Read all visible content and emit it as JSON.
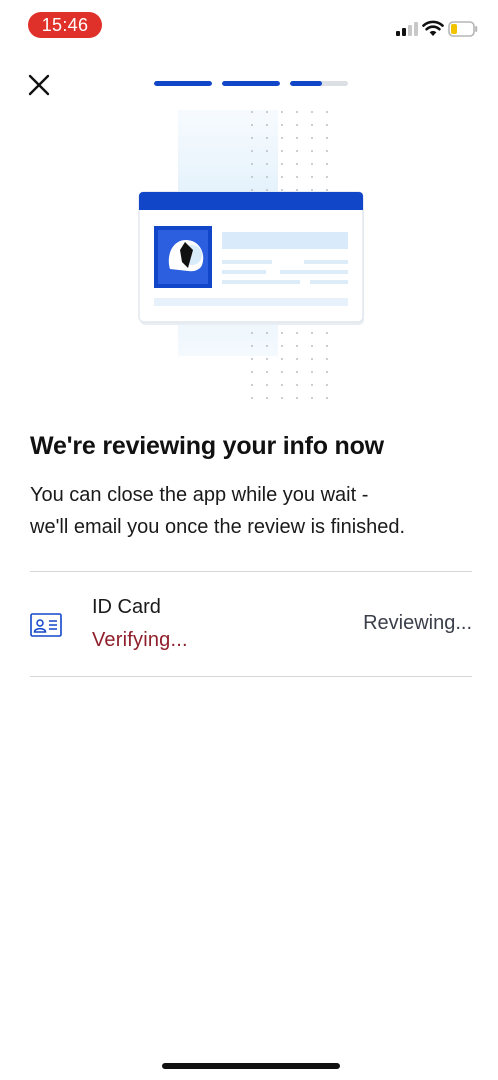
{
  "status_bar": {
    "time": "15:46",
    "time_pill_color": "#e0302a",
    "signal_icon": "cellular-signal-icon",
    "wifi_icon": "wifi-icon",
    "battery_icon": "battery-low-icon",
    "battery_level": 0.2
  },
  "top_bar": {
    "close_icon": "close-icon",
    "progress_steps": [
      1.0,
      1.0,
      0.55
    ],
    "accent_color": "#1246c9"
  },
  "illustration": {
    "icon": "id-card-illustration-icon"
  },
  "content": {
    "title": "We're reviewing your info now",
    "body_line_1": "You can close the app while you wait -",
    "body_line_2": "we'll email you once the review is finished."
  },
  "document": {
    "icon": "id-card-icon",
    "name": "ID Card",
    "substatus": "Verifying...",
    "substatus_color": "#8f1f2a",
    "status": "Reviewing..."
  }
}
